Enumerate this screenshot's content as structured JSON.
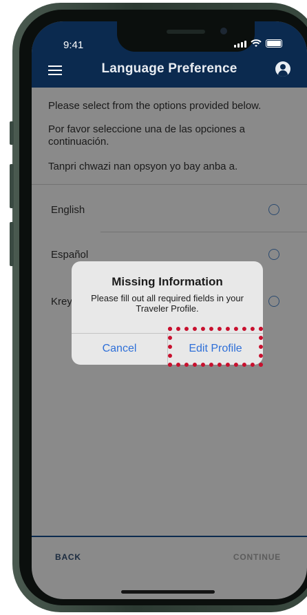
{
  "status_bar": {
    "time": "9:41"
  },
  "header": {
    "title": "Language Preference"
  },
  "instructions": {
    "english": "Please select from the options provided below.",
    "spanish": "Por favor seleccione una de las opciones a continuación.",
    "creole": "Tanpri chwazi nan opsyon yo bay anba a."
  },
  "languages": [
    {
      "label": "English",
      "selected": false
    },
    {
      "label": "Español",
      "selected": false
    },
    {
      "label": "Kreyòl",
      "visible_text": "Krey",
      "selected": false
    }
  ],
  "dialog": {
    "title": "Missing Information",
    "message": "Please fill out all required fields in your Traveler Profile.",
    "cancel_label": "Cancel",
    "edit_label": "Edit Profile"
  },
  "footer": {
    "back_label": "BACK",
    "continue_label": "CONTINUE"
  },
  "colors": {
    "header_bg": "#0b2a4f",
    "dim_overlay": "#8a8a8a",
    "ios_blue": "#2e6fd8",
    "highlight": "#c8102e"
  },
  "icons": [
    "menu-icon",
    "profile-icon",
    "radio-icon",
    "signal-icon",
    "wifi-icon",
    "battery-icon"
  ]
}
